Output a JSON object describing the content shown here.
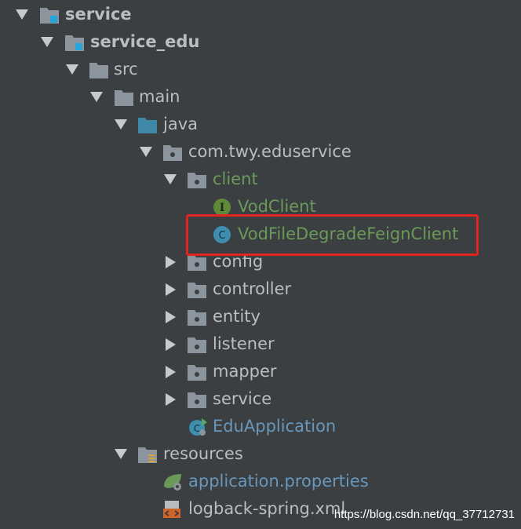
{
  "colors": {
    "background": "#3c3f41",
    "text": "#bbbdbf",
    "green_text": "#6a9a5a",
    "blue_text": "#6897bb",
    "highlight_border": "#e3231f",
    "folder": "#8c959d",
    "source_folder": "#3f88a7",
    "module_badge": "#27a4d8"
  },
  "tree": {
    "service": "service",
    "service_edu": "service_edu",
    "src": "src",
    "main": "main",
    "java": "java",
    "package": "com.twy.eduservice",
    "client": "client",
    "vod_client": "VodClient",
    "vod_client_badge": "I",
    "degrade_client": "VodFileDegradeFeignClient",
    "degrade_client_badge": "C",
    "config": "config",
    "controller": "controller",
    "entity": "entity",
    "listener": "listener",
    "mapper": "mapper",
    "service_pkg": "service",
    "edu_application": "EduApplication",
    "resources": "resources",
    "application_properties": "application.properties",
    "logback": "logback-spring.xml"
  },
  "icons": {
    "module": "module-folder-icon",
    "folder": "folder-icon",
    "source_root": "source-root-folder-icon",
    "package": "package-icon",
    "interface": "interface-icon",
    "class": "class-icon",
    "spring_boot_app": "spring-boot-class-icon",
    "resources": "resources-folder-icon",
    "spring_properties": "spring-properties-icon",
    "xml": "xml-file-icon"
  },
  "watermark": "https://blog.csdn.net/qq_37712731"
}
